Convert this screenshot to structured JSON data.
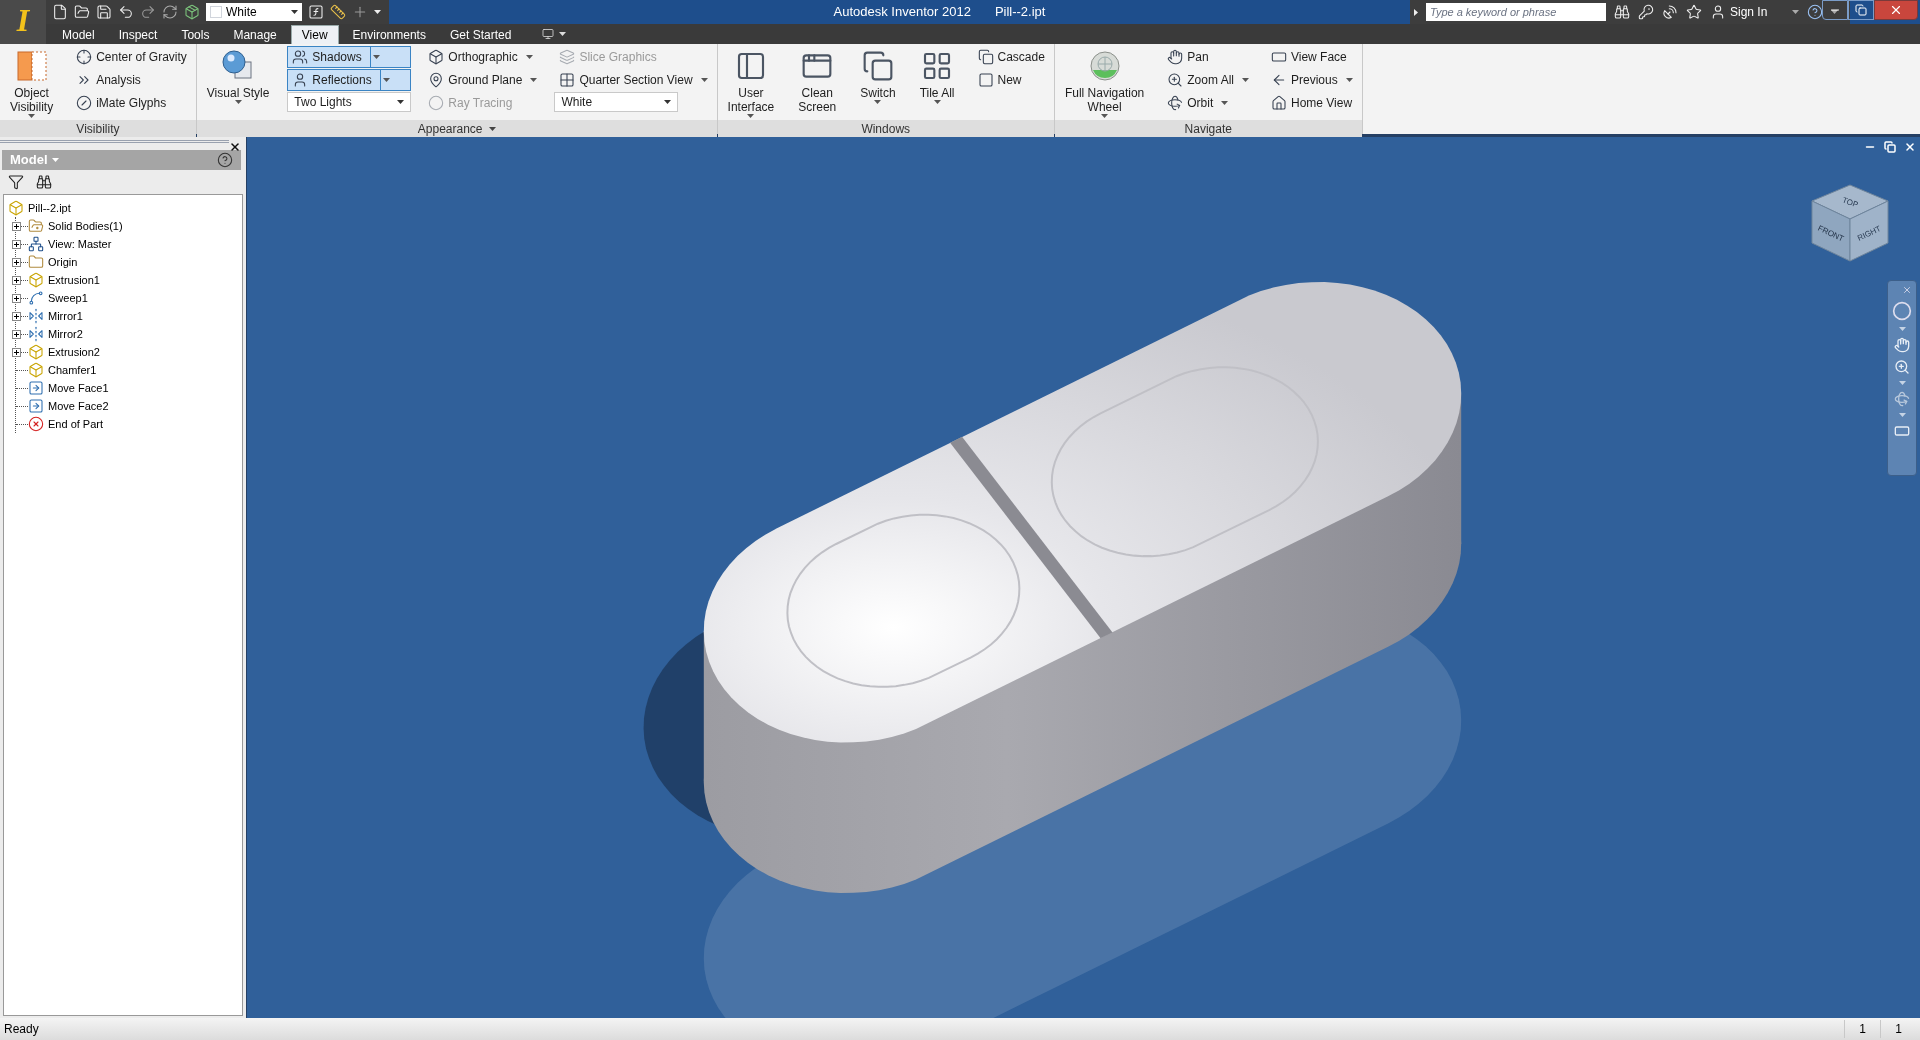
{
  "app_menu": {
    "letter": "I"
  },
  "quick_access": {
    "appearance": "White"
  },
  "title": {
    "app": "Autodesk Inventor 2012",
    "document": "Pill--2.ipt"
  },
  "help_search": {
    "placeholder": "Type a keyword or phrase",
    "sign_in": "Sign In"
  },
  "tabs": [
    {
      "label": "Model",
      "selected": false
    },
    {
      "label": "Inspect",
      "selected": false
    },
    {
      "label": "Tools",
      "selected": false
    },
    {
      "label": "Manage",
      "selected": false
    },
    {
      "label": "View",
      "selected": true
    },
    {
      "label": "Environments",
      "selected": false
    },
    {
      "label": "Get Started",
      "selected": false
    }
  ],
  "ribbon": [
    {
      "title": "Visibility",
      "menu": false,
      "columns": [
        [
          {
            "kind": "large",
            "label": "Object\nVisibility",
            "dropdown": true,
            "disabled": false
          }
        ],
        [
          {
            "kind": "small",
            "label": "Center of Gravity",
            "dropdown": false,
            "disabled": false
          },
          {
            "kind": "small",
            "label": "Analysis",
            "dropdown": false,
            "disabled": false
          },
          {
            "kind": "small",
            "label": "iMate Glyphs",
            "dropdown": false,
            "disabled": false
          }
        ]
      ]
    },
    {
      "title": "Appearance",
      "menu": true,
      "columns": [
        [
          {
            "kind": "large",
            "label": "Visual Style",
            "dropdown": true,
            "disabled": false
          }
        ],
        [
          {
            "kind": "toggle",
            "label": "Shadows",
            "on": true,
            "dropdown": true,
            "disabled": false
          },
          {
            "kind": "toggle",
            "label": "Reflections",
            "on": true,
            "dropdown": true,
            "disabled": false
          },
          {
            "kind": "combo",
            "label": "Two Lights",
            "dropdown": true,
            "disabled": false
          }
        ],
        [
          {
            "kind": "small",
            "label": "Orthographic",
            "dropdown": true,
            "disabled": false
          },
          {
            "kind": "small",
            "label": "Ground Plane",
            "dropdown": true,
            "disabled": false
          },
          {
            "kind": "small",
            "label": "Ray Tracing",
            "dropdown": false,
            "disabled": true
          }
        ],
        [
          {
            "kind": "small",
            "label": "Slice Graphics",
            "dropdown": false,
            "disabled": true
          },
          {
            "kind": "small",
            "label": "Quarter Section View",
            "dropdown": true,
            "disabled": false
          },
          {
            "kind": "combo",
            "label": "White",
            "dropdown": true,
            "disabled": false
          }
        ]
      ]
    },
    {
      "title": "Windows",
      "menu": false,
      "columns": [
        [
          {
            "kind": "large",
            "label": "User\nInterface",
            "dropdown": true,
            "disabled": false
          }
        ],
        [
          {
            "kind": "large",
            "label": "Clean\nScreen",
            "dropdown": false,
            "disabled": false
          }
        ],
        [
          {
            "kind": "large",
            "label": "Switch",
            "dropdown": true,
            "disabled": false
          }
        ],
        [
          {
            "kind": "large",
            "label": "Tile All",
            "dropdown": true,
            "disabled": false
          }
        ],
        [
          {
            "kind": "small",
            "label": "Cascade",
            "dropdown": false,
            "disabled": false
          },
          {
            "kind": "small",
            "label": "New",
            "dropdown": false,
            "disabled": false
          }
        ]
      ]
    },
    {
      "title": "Navigate",
      "menu": false,
      "columns": [
        [
          {
            "kind": "large",
            "label": "Full Navigation\nWheel",
            "dropdown": true,
            "disabled": false
          }
        ],
        [
          {
            "kind": "small",
            "label": "Pan",
            "dropdown": false,
            "disabled": false
          },
          {
            "kind": "small",
            "label": "Zoom All",
            "dropdown": true,
            "disabled": false
          },
          {
            "kind": "small",
            "label": "Orbit",
            "dropdown": true,
            "disabled": false
          }
        ],
        [
          {
            "kind": "small",
            "label": "View Face",
            "dropdown": false,
            "disabled": false
          },
          {
            "kind": "small",
            "label": "Previous",
            "dropdown": true,
            "disabled": false
          },
          {
            "kind": "small",
            "label": "Home View",
            "dropdown": false,
            "disabled": false
          }
        ]
      ]
    }
  ],
  "browser": {
    "title": "Model",
    "tree": {
      "label": "Pill--2.ipt",
      "children": [
        {
          "label": "Solid Bodies(1)",
          "expandable": true,
          "expanded": false
        },
        {
          "label": "View: Master",
          "expandable": true,
          "expanded": false
        },
        {
          "label": "Origin",
          "expandable": true,
          "expanded": false
        },
        {
          "label": "Extrusion1",
          "expandable": true,
          "expanded": false
        },
        {
          "label": "Sweep1",
          "expandable": true,
          "expanded": false
        },
        {
          "label": "Mirror1",
          "expandable": true,
          "expanded": false
        },
        {
          "label": "Mirror2",
          "expandable": true,
          "expanded": false
        },
        {
          "label": "Extrusion2",
          "expandable": true,
          "expanded": false
        },
        {
          "label": "Chamfer1",
          "expandable": false
        },
        {
          "label": "Move Face1",
          "expandable": false
        },
        {
          "label": "Move Face2",
          "expandable": false
        },
        {
          "label": "End of Part",
          "expandable": false
        }
      ]
    }
  },
  "view_cube": {
    "top": "TOP",
    "front": "FRONT",
    "right": "RIGHT"
  },
  "status_bar": {
    "message": "Ready",
    "fields": [
      "1",
      "1"
    ]
  }
}
